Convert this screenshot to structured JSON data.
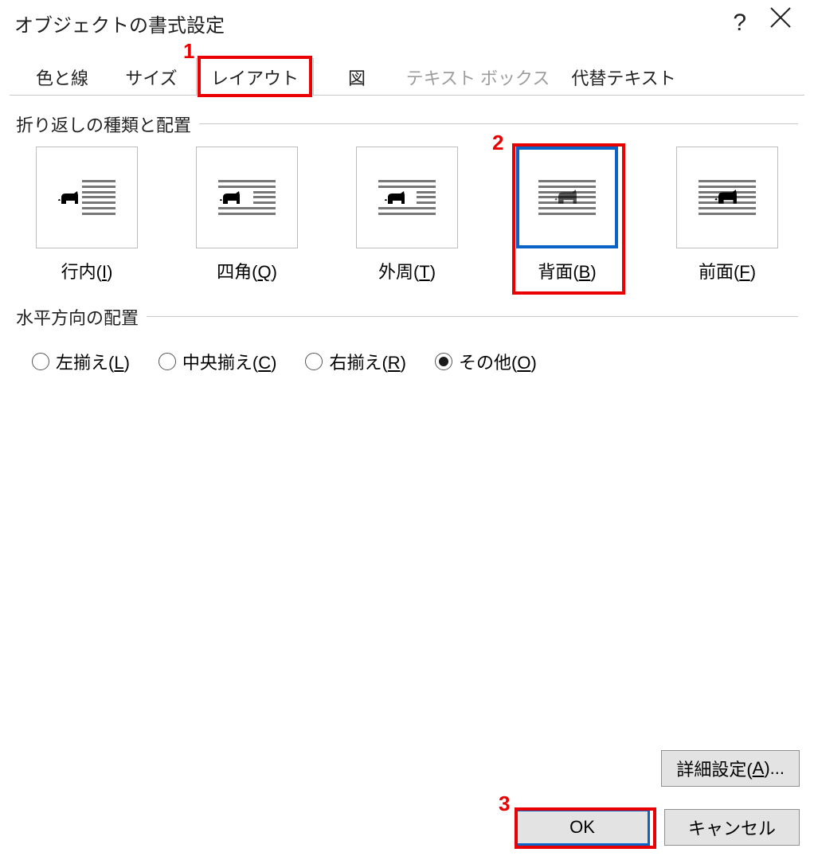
{
  "dialog": {
    "title": "オブジェクトの書式設定",
    "help": "?",
    "tabs": [
      {
        "label": "色と線"
      },
      {
        "label": "サイズ"
      },
      {
        "label": "レイアウト",
        "selected": true
      },
      {
        "label": "図"
      },
      {
        "label": "テキスト ボックス",
        "disabled": true
      },
      {
        "label": "代替テキスト"
      }
    ]
  },
  "sections": {
    "wrap_title": "折り返しの種類と配置",
    "wrap_options": [
      {
        "label_pre": "行内(",
        "key": "I",
        "label_post": ")",
        "kind": "inline"
      },
      {
        "label_pre": "四角(",
        "key": "Q",
        "label_post": ")",
        "kind": "square"
      },
      {
        "label_pre": "外周(",
        "key": "T",
        "label_post": ")",
        "kind": "tight"
      },
      {
        "label_pre": "背面(",
        "key": "B",
        "label_post": ")",
        "kind": "behind",
        "selected": true
      },
      {
        "label_pre": "前面(",
        "key": "F",
        "label_post": ")",
        "kind": "front"
      }
    ],
    "align_title": "水平方向の配置",
    "align_options": [
      {
        "label_pre": "左揃え(",
        "key": "L",
        "label_post": ")"
      },
      {
        "label_pre": "中央揃え(",
        "key": "C",
        "label_post": ")"
      },
      {
        "label_pre": "右揃え(",
        "key": "R",
        "label_post": ")"
      },
      {
        "label_pre": "その他(",
        "key": "O",
        "label_post": ")",
        "checked": true
      }
    ]
  },
  "buttons": {
    "advanced_pre": "詳細設定(",
    "advanced_key": "A",
    "advanced_post": ")...",
    "ok": "OK",
    "cancel": "キャンセル"
  },
  "annotations": {
    "n1": "1",
    "n2": "2",
    "n3": "3"
  }
}
